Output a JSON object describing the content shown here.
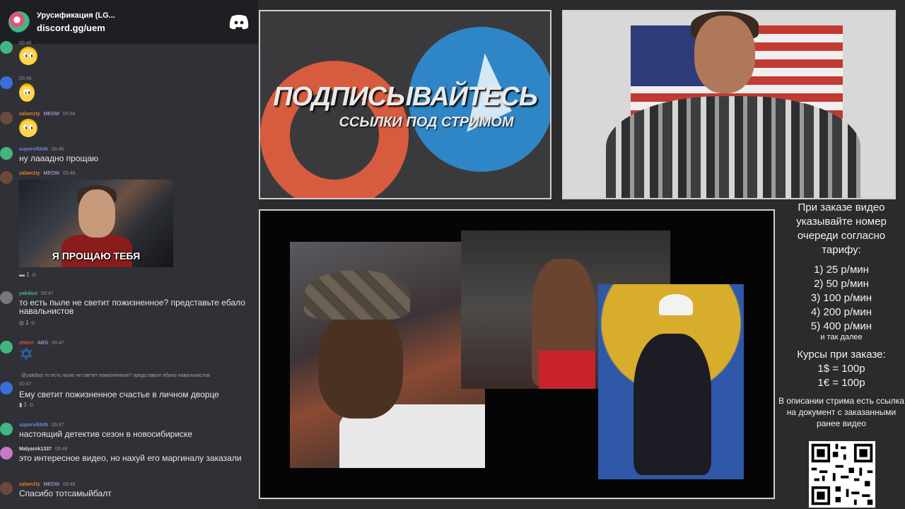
{
  "discord": {
    "server_name": "Урусификация (LG...",
    "invite": "discord.gg/uem",
    "logo_icon": "discord-icon"
  },
  "chat": [
    {
      "author": "",
      "badge": "",
      "time": "00:46",
      "type": "emoji",
      "emoji": "pleading-face"
    },
    {
      "author": "",
      "badge": "",
      "time": "00:46",
      "type": "emoji",
      "emoji": "surprised-face"
    },
    {
      "author": "zalam1ty",
      "badge": "MEOW",
      "time": "00:46",
      "type": "emoji",
      "emoji": "pleading-face"
    },
    {
      "author": "supervillAIN",
      "badge": "",
      "time": "00:46",
      "type": "text",
      "text": "ну лааадно прощаю"
    },
    {
      "author": "zalam1ty",
      "badge": "MEOW",
      "time": "00:46",
      "type": "image",
      "caption": "Я ПРОЩАЮ ТЕБЯ",
      "reaction_count": "1"
    },
    {
      "author": "yakdast",
      "badge": "",
      "time": "00:47",
      "type": "text",
      "text": "то есть пыле не светит пожизненное? представьте ебало навальнистов",
      "reaction_count": "1"
    },
    {
      "author": "zhtierr",
      "badge": "ARG",
      "time": "00:47",
      "type": "emoji",
      "emoji": "star-of-david"
    },
    {
      "author": "",
      "badge": "",
      "time": "00:47",
      "type": "reply",
      "quote": "@yakdast то есть пыле не светит пожизненное? представьте ебало навальнистов",
      "text": "Ему светит пожизненное счастье в личном дворце",
      "reaction_count": "1"
    },
    {
      "author": "supervillAIN",
      "badge": "",
      "time": "00:47",
      "type": "text",
      "text": "настоящий детектив сезон в новосибириске"
    },
    {
      "author": "Malyarok1337",
      "badge": "",
      "time": "00:48",
      "type": "text",
      "text": "это интересное видео, но нахуй его маргиналу заказали"
    },
    {
      "author": "zalam1ty",
      "badge": "MEOW",
      "time": "00:48",
      "type": "text",
      "text": "Спасибо тотсамыйбалт"
    }
  ],
  "promo": {
    "headline": "ПОДПИСЫВАЙТЕСЬ",
    "subline": "ССЫЛКИ ПОД СТРИМОМ"
  },
  "order_info": {
    "intro": "При заказе видео указывайте номер очереди согласно тарифу:",
    "tiers": [
      "1) 25 р/мин",
      "2) 50 р/мин",
      "3) 100 р/мин",
      "4) 200 р/мин",
      "5) 400 р/мин"
    ],
    "etc": "и так далее",
    "rates_title": "Курсы при заказе:",
    "rates": [
      "1$ = 100р",
      "1€ = 100р"
    ],
    "description": "В описании стрима есть ссылка на документ с заказанными ранее видео"
  },
  "colors": {
    "chat_bg": "#2f3136",
    "discord_bar": "#1e1f22",
    "author_green": "#43b581",
    "author_orange": "#e67e22",
    "author_red": "#e74c3c",
    "author_blue": "#7289da",
    "patreon": "#d75b3e",
    "telegram": "#2e86c6"
  }
}
